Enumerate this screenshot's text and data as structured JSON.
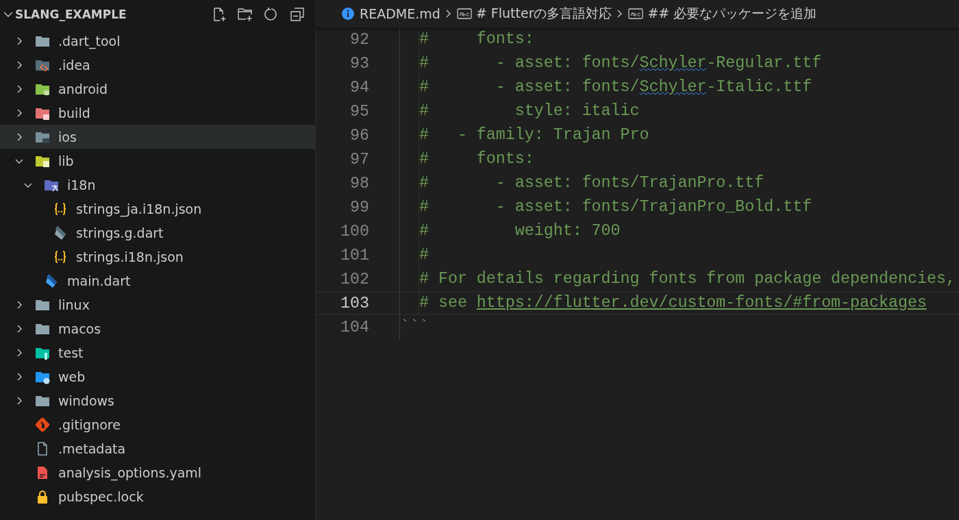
{
  "explorer": {
    "title": "SLANG_EXAMPLE",
    "expanded": true,
    "tree": [
      {
        "label": ".dart_tool",
        "kind": "folder",
        "expanded": false,
        "selected": false
      },
      {
        "label": ".idea",
        "kind": "ideafolder",
        "expanded": false,
        "selected": false
      },
      {
        "label": "android",
        "kind": "androidfolder",
        "expanded": false,
        "selected": false
      },
      {
        "label": "build",
        "kind": "buildfolder",
        "expanded": false,
        "selected": false
      },
      {
        "label": "ios",
        "kind": "iosfolder",
        "expanded": false,
        "selected": true
      },
      {
        "label": "lib",
        "kind": "libfolder",
        "expanded": true,
        "selected": false,
        "children": [
          {
            "label": "i18n",
            "kind": "i18nfolder",
            "expanded": true,
            "selected": false,
            "children": [
              {
                "label": "strings_ja.i18n.json",
                "kind": "jsonfile",
                "selected": false
              },
              {
                "label": "strings.g.dart",
                "kind": "gendartfile",
                "selected": false
              },
              {
                "label": "strings.i18n.json",
                "kind": "jsonfile",
                "selected": false
              }
            ]
          },
          {
            "label": "main.dart",
            "kind": "dartfile",
            "selected": false
          }
        ]
      },
      {
        "label": "linux",
        "kind": "folder",
        "expanded": false,
        "selected": false
      },
      {
        "label": "macos",
        "kind": "folder",
        "expanded": false,
        "selected": false
      },
      {
        "label": "test",
        "kind": "testfolder",
        "expanded": false,
        "selected": false
      },
      {
        "label": "web",
        "kind": "webfolder",
        "expanded": false,
        "selected": false
      },
      {
        "label": "windows",
        "kind": "folder",
        "expanded": false,
        "selected": false
      },
      {
        "label": ".gitignore",
        "kind": "gitfile",
        "selected": false
      },
      {
        "label": ".metadata",
        "kind": "textfile",
        "selected": false
      },
      {
        "label": "analysis_options.yaml",
        "kind": "yamlfile",
        "selected": false
      },
      {
        "label": "pubspec.lock",
        "kind": "lockfile",
        "selected": false
      }
    ]
  },
  "breadcrumb": [
    {
      "kind": "file",
      "label": "README.md"
    },
    {
      "kind": "section",
      "label": "# Flutterの多言語対応"
    },
    {
      "kind": "section",
      "label": "## 必要なパッケージを追加"
    }
  ],
  "editor": {
    "lines": [
      {
        "number": "92",
        "current": false,
        "segments": [
          {
            "kind": "text",
            "text": "  #     fonts:"
          }
        ]
      },
      {
        "number": "93",
        "current": false,
        "segments": [
          {
            "kind": "text",
            "text": "  #       - asset: fonts/"
          },
          {
            "kind": "misspelled",
            "text": "Schyler"
          },
          {
            "kind": "text",
            "text": "-Regular.ttf"
          }
        ]
      },
      {
        "number": "94",
        "current": false,
        "segments": [
          {
            "kind": "text",
            "text": "  #       - asset: fonts/"
          },
          {
            "kind": "misspelled",
            "text": "Schyler"
          },
          {
            "kind": "text",
            "text": "-Italic.ttf"
          }
        ]
      },
      {
        "number": "95",
        "current": false,
        "segments": [
          {
            "kind": "text",
            "text": "  #         style: italic"
          }
        ]
      },
      {
        "number": "96",
        "current": false,
        "segments": [
          {
            "kind": "text",
            "text": "  #   - family: Trajan Pro"
          }
        ]
      },
      {
        "number": "97",
        "current": false,
        "segments": [
          {
            "kind": "text",
            "text": "  #     fonts:"
          }
        ]
      },
      {
        "number": "98",
        "current": false,
        "segments": [
          {
            "kind": "text",
            "text": "  #       - asset: fonts/TrajanPro.ttf"
          }
        ]
      },
      {
        "number": "99",
        "current": false,
        "segments": [
          {
            "kind": "text",
            "text": "  #       - asset: fonts/TrajanPro_Bold.ttf"
          }
        ]
      },
      {
        "number": "100",
        "current": false,
        "segments": [
          {
            "kind": "text",
            "text": "  #         weight: 700"
          }
        ]
      },
      {
        "number": "101",
        "current": false,
        "segments": [
          {
            "kind": "text",
            "text": "  #"
          }
        ]
      },
      {
        "number": "102",
        "current": false,
        "segments": [
          {
            "kind": "text",
            "text": "  # For details regarding fonts from package dependencies,"
          }
        ]
      },
      {
        "number": "103",
        "current": true,
        "segments": [
          {
            "kind": "text",
            "text": "  # see "
          },
          {
            "kind": "link",
            "text": "https://flutter.dev/custom-fonts/#from-packages"
          }
        ]
      },
      {
        "number": "104",
        "current": false,
        "segments": [
          {
            "kind": "text",
            "text": "```"
          }
        ]
      }
    ]
  }
}
